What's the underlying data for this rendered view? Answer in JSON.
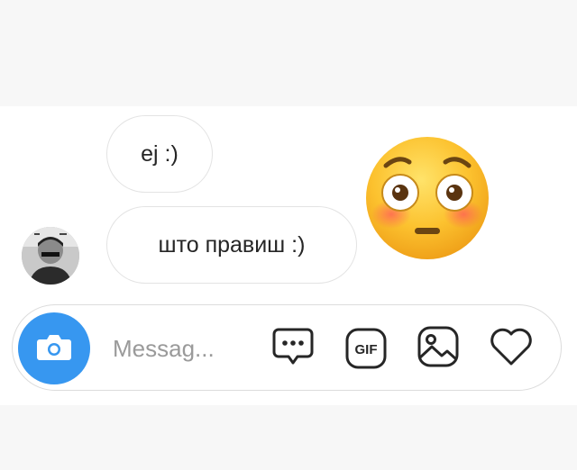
{
  "messages": [
    {
      "text": "ej :)"
    },
    {
      "text": "што правиш :)"
    }
  ],
  "reaction": {
    "icon": "flushed-face-emoji"
  },
  "avatar": {
    "icon": "user-avatar-photo"
  },
  "composer": {
    "placeholder": "Messag...",
    "camera_icon": "camera-icon",
    "tools": [
      {
        "icon": "chat-bubble-icon"
      },
      {
        "icon": "gif-icon",
        "label": "GIF"
      },
      {
        "icon": "image-icon"
      },
      {
        "icon": "heart-icon"
      }
    ]
  },
  "colors": {
    "accent": "#3797f0",
    "bubble_border": "#e3e3e3",
    "text": "#262626",
    "placeholder": "#9a9a9a"
  }
}
